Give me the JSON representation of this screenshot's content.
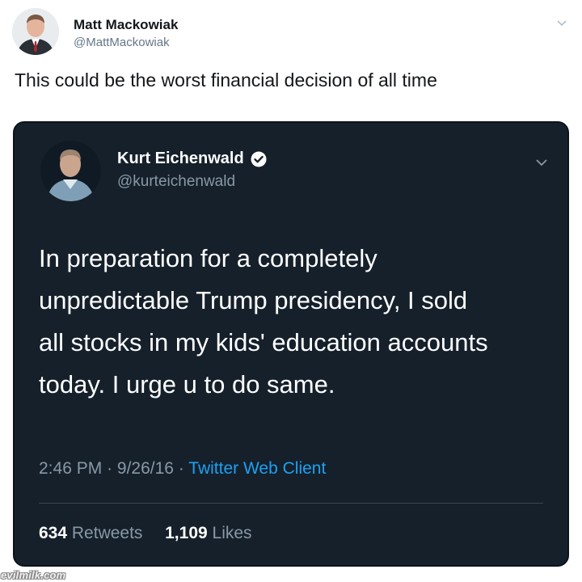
{
  "outer_tweet": {
    "name": "Matt Mackowiak",
    "handle": "@MattMackowiak",
    "text": "This could be the worst financial decision of all time"
  },
  "quoted_tweet": {
    "name": "Kurt Eichenwald",
    "handle": "@kurteichenwald",
    "body_lines": [
      "In preparation for a completely",
      "unpredictable Trump presidency, I sold",
      "all stocks in my kids' education accounts",
      "today. I urge u to do same."
    ],
    "time": "2:46 PM",
    "date": "9/26/16",
    "separator": "·",
    "source": "Twitter Web Client",
    "retweets_count": "634",
    "retweets_label": "Retweets",
    "likes_count": "1,109",
    "likes_label": "Likes"
  },
  "watermark": "evilmilk.com",
  "colors": {
    "card_bg": "#15202b",
    "link": "#1da1f2",
    "muted": "#8899a6"
  },
  "icons": [
    "avatar",
    "chevron-down-icon",
    "verified-icon"
  ]
}
